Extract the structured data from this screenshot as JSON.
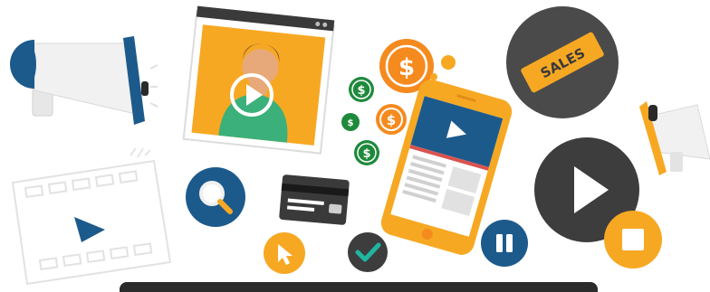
{
  "badge": {
    "sales_label": "SALES"
  },
  "currency": {
    "symbol": "$"
  },
  "colors": {
    "accent_orange": "#f7a823",
    "coin_orange": "#f58a1f",
    "coin_green": "#1e8a3c",
    "navy_blue": "#1d5a8c",
    "dark_gray": "#3d3d3d",
    "teal_check": "#1fb5a0",
    "person_green": "#3bb07a",
    "bar_dark": "#2b2b2b"
  },
  "icons": [
    "megaphone-icon",
    "video-player-icon",
    "play-icon",
    "dollar-coin-icon",
    "sales-badge-icon",
    "smartphone-icon",
    "storyboard-icon",
    "search-icon",
    "credit-card-icon",
    "cursor-arrow-icon",
    "checkmark-icon",
    "pause-icon",
    "stop-icon"
  ]
}
